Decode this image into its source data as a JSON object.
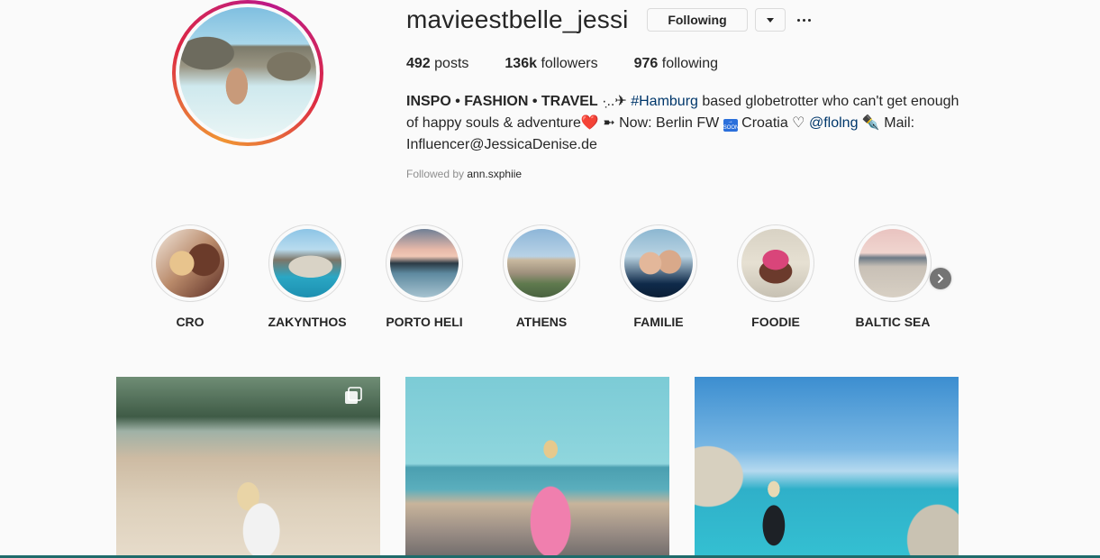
{
  "profile": {
    "username": "mavieestbelle_jessi",
    "following_button": "Following",
    "stats": {
      "posts_count": "492",
      "posts_label": "posts",
      "followers_count": "136k",
      "followers_label": "followers",
      "following_count": "976",
      "following_label": "following"
    },
    "bio": {
      "headline": "INSPO • FASHION • TRAVEL",
      "sparkle": " ·.̣.✈ ",
      "hashtag": "#Hamburg",
      "text1": " based globetrotter who can't get enough of happy souls & adventure",
      "heart": "❤️",
      "arrow": " ➼ ",
      "text2": "Now: Berlin FW ",
      "soon_icon": "soon-arrow-icon",
      "soon_text": "SOON",
      "text3": " Croatia ♡ ",
      "mention": "@flolng",
      "pen": " ✒️ ",
      "text4": "Mail: Influencer@JessicaDenise.de"
    },
    "followed_by_prefix": "Followed by ",
    "followed_by_user": "ann.sxphiie"
  },
  "highlights": [
    {
      "label": "CRO",
      "icon": "highlight-cover"
    },
    {
      "label": "ZAKYNTHOS",
      "icon": "highlight-cover"
    },
    {
      "label": "PORTO HELI",
      "icon": "highlight-cover"
    },
    {
      "label": "ATHENS",
      "icon": "highlight-cover"
    },
    {
      "label": "FAMILIE",
      "icon": "highlight-cover"
    },
    {
      "label": "FOODIE",
      "icon": "highlight-cover"
    },
    {
      "label": "BALTIC SEA",
      "icon": "highlight-cover"
    }
  ],
  "posts": [
    {
      "type": "carousel",
      "icon": "multiple-images-icon"
    },
    {
      "type": "image"
    },
    {
      "type": "image"
    }
  ],
  "colors": {
    "link": "#00376b",
    "text": "#262626",
    "muted": "#8e8e8e",
    "border": "#dbdbdb",
    "background": "#fafafa"
  }
}
